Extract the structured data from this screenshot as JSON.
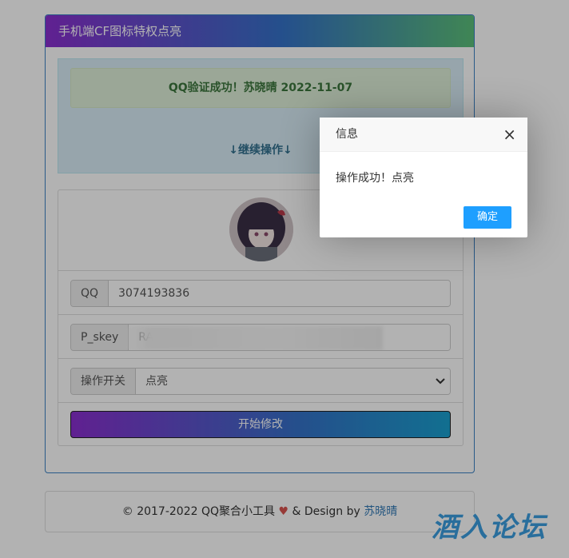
{
  "card": {
    "title": "手机端CF图标特权点亮"
  },
  "alert": {
    "success_text": "QQ验证成功！苏晓晴 2022-11-07",
    "continue_text": "↓继续操作↓"
  },
  "form": {
    "qq": {
      "label": "QQ",
      "value": "3074193836"
    },
    "pskey": {
      "label": "P_skey",
      "value": "RAN"
    },
    "operation": {
      "label": "操作开关",
      "selected": "点亮",
      "options": [
        "点亮"
      ]
    },
    "submit_label": "开始修改"
  },
  "footer": {
    "copyright": "© 2017-2022  QQ聚合小工具",
    "heart": "♥",
    "design_by": "& Design by",
    "author": "苏晓晴"
  },
  "dialog": {
    "title": "信息",
    "close_icon": "×",
    "message": "操作成功！点亮",
    "confirm_label": "确定"
  },
  "watermark": {
    "text": "酒入论坛"
  },
  "colors": {
    "header_gradient_start": "#8a2fd0",
    "header_gradient_end": "#5cc07a",
    "dialog_button": "#1e9fff",
    "success_text": "#3c763d"
  }
}
